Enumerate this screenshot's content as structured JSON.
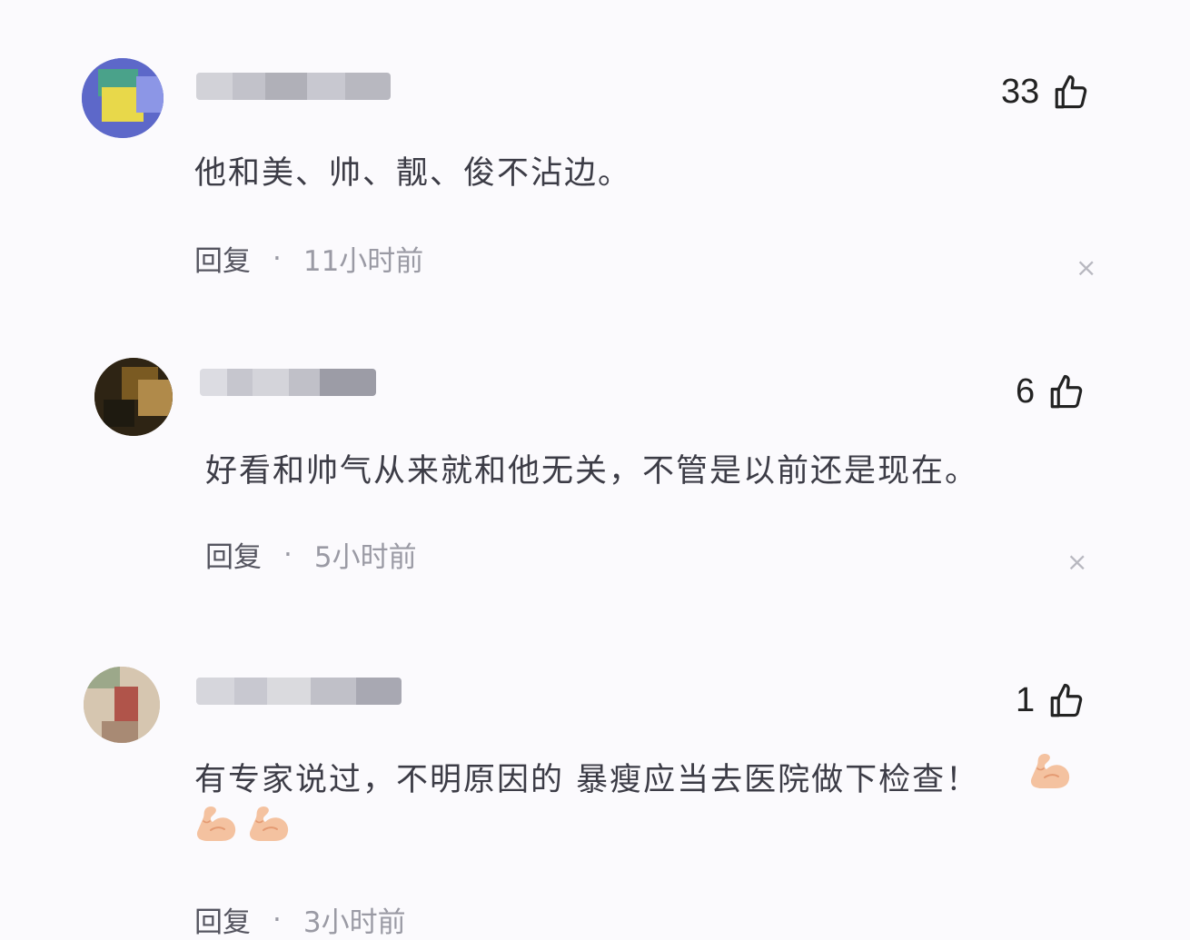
{
  "comments": [
    {
      "likes": "33",
      "text": "他和美、帅、靓、俊不沾边。",
      "reply_label": "回复",
      "separator": "·",
      "time": "11小时前",
      "close": "×"
    },
    {
      "likes": "6",
      "text": "好看和帅气从来就和他无关，不管是以前还是现在。",
      "reply_label": "回复",
      "separator": "·",
      "time": "5小时前",
      "close": "×"
    },
    {
      "likes": "1",
      "text": "有专家说过，不明原因的 暴瘦应当去医院做下检查！",
      "reply_label": "回复",
      "separator": "·",
      "time": "3小时前"
    }
  ],
  "icons": {
    "like": "thumbs-up-outline-icon",
    "close": "close-icon",
    "emoji": "flexed-biceps-emoji"
  },
  "colors": {
    "background": "#fbfafd",
    "text": "#3c3c46",
    "muted": "#9a9aa4",
    "emoji_skin": "#f6c8a8"
  }
}
